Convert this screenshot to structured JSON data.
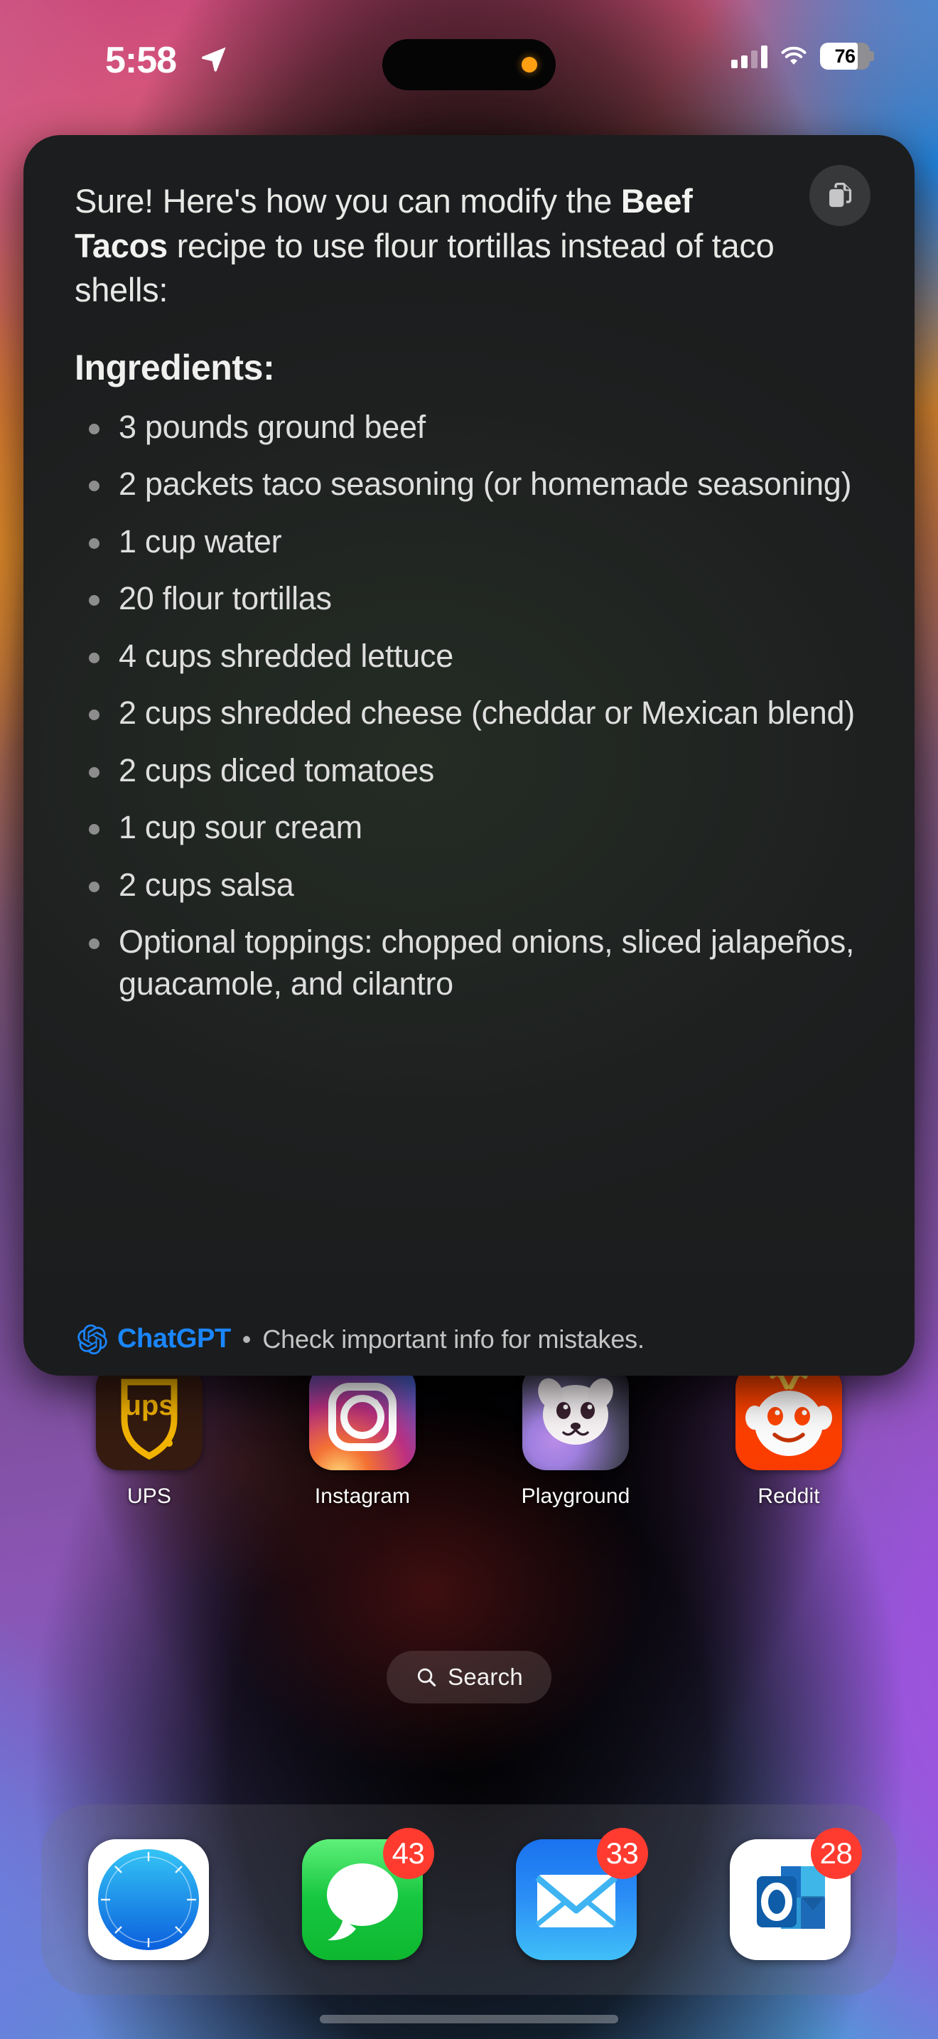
{
  "status_bar": {
    "time": "5:58",
    "location_icon": "location-arrow-icon",
    "cellular_icon": "cellular-signal-icon",
    "wifi_icon": "wifi-icon",
    "battery_percent": "76",
    "battery_level": 76
  },
  "dynamic_island": {
    "privacy_indicator": "microphone-active-dot",
    "privacy_color": "#ffa012"
  },
  "card": {
    "copy_button_icon": "copy-document-icon",
    "intro_part1": "Sure! Here's how you can modify the ",
    "intro_bold": "Beef Tacos",
    "intro_part2": " recipe to use flour tortillas instead of taco shells:",
    "heading": "Ingredients:",
    "ingredients": [
      "3 pounds ground beef",
      "2 packets taco seasoning (or homemade seasoning)",
      "1 cup water",
      "20 flour tortillas",
      "4 cups shredded lettuce",
      "2 cups shredded cheese (cheddar or Mexican blend)",
      "2 cups diced tomatoes",
      "1 cup sour cream",
      "2 cups salsa",
      "Optional toppings: chopped onions, sliced jalapeños, guacamole, and cilantro"
    ],
    "footer": {
      "logo_icon": "openai-logo-icon",
      "brand": "ChatGPT",
      "separator": "•",
      "disclaimer": "Check important info for mistakes.",
      "brand_color": "#1a86ff"
    }
  },
  "home_screen": {
    "apps": [
      {
        "label": "UPS",
        "icon": "ups-shield-icon",
        "wordmark": "ups"
      },
      {
        "label": "Instagram",
        "icon": "instagram-camera-icon"
      },
      {
        "label": "Playground",
        "icon": "playground-dog-icon"
      },
      {
        "label": "Reddit",
        "icon": "reddit-alien-icon"
      }
    ],
    "search": {
      "label": "Search",
      "icon": "search-magnifier-icon"
    }
  },
  "dock": {
    "items": [
      {
        "label": "Safari",
        "icon": "safari-compass-icon",
        "badge": null
      },
      {
        "label": "Messages",
        "icon": "messages-bubble-icon",
        "badge": "43"
      },
      {
        "label": "Mail",
        "icon": "mail-envelope-icon",
        "badge": "33"
      },
      {
        "label": "Outlook",
        "icon": "outlook-icon",
        "badge": "28"
      }
    ],
    "badge_color": "#ff3b30"
  },
  "wallpaper": {
    "top_left": "#c9487a",
    "top_right": "#2f97e8",
    "mid_left": "#d8862c",
    "bottom_right": "#a24fe0",
    "bottom_left": "#6a7fe0"
  }
}
